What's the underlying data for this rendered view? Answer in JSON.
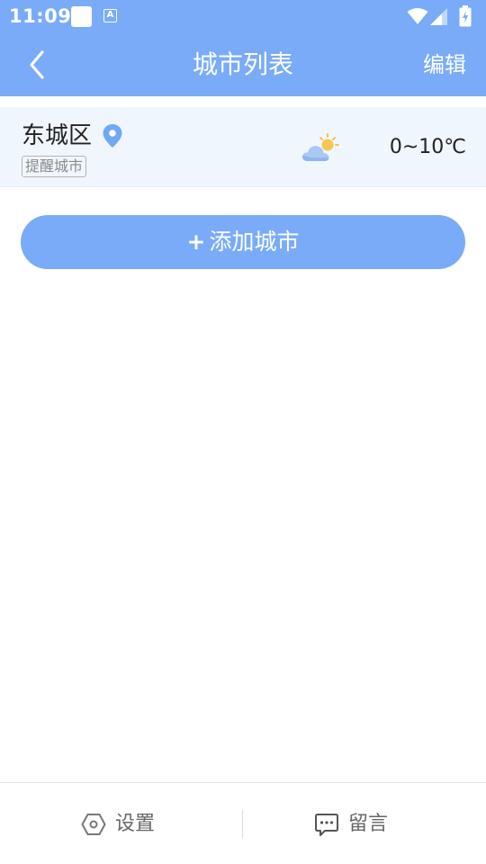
{
  "status_bar": {
    "time": "11:09",
    "a_icon_label": "A"
  },
  "header": {
    "title": "城市列表",
    "edit_label": "编辑",
    "back_icon": "chevron-left-icon"
  },
  "cities": [
    {
      "name": "东城区",
      "tag": "提醒城市",
      "temperature": "0~10℃",
      "weather_icon": "partly-cloudy-icon",
      "location_icon": "location-pin-icon"
    }
  ],
  "add_city_button": {
    "plus": "+",
    "label": "添加城市"
  },
  "bottom_nav": {
    "settings_label": "设置",
    "settings_icon": "settings-hexagon-icon",
    "feedback_label": "留言",
    "feedback_icon": "chat-bubble-icon"
  },
  "colors": {
    "primary": "#79abf8",
    "row_background": "#f0f6fe"
  }
}
